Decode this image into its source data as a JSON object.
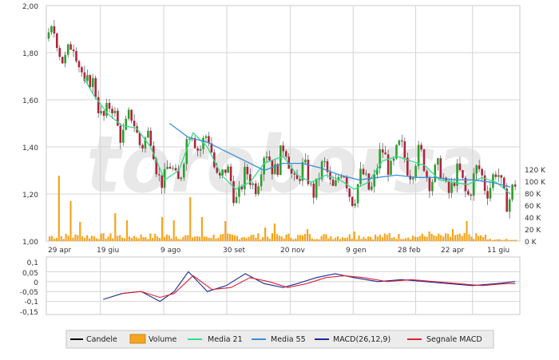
{
  "watermark": "toroborsa",
  "price_panel": {
    "y_ticks": [
      "2,00",
      "1,80",
      "1,60",
      "1,40",
      "1,20",
      "1,00"
    ],
    "volume_ticks": [
      "120 K",
      "100 K",
      "80 K",
      "60 K",
      "40 K",
      "20 K",
      "0 K"
    ],
    "x_ticks": [
      "29 apr",
      "19 giu",
      "9 ago",
      "30 set",
      "20 nov",
      "9 gen",
      "28 feb",
      "22 apr",
      "11 giu"
    ]
  },
  "macd_panel": {
    "y_ticks": [
      "0,1",
      "0,05",
      "0",
      "-0,05",
      "-0,1",
      "-0,15"
    ]
  },
  "legend": [
    {
      "label": "Candele",
      "color": "#000000",
      "kind": "line"
    },
    {
      "label": "Volume",
      "color": "#f5a51f",
      "kind": "box"
    },
    {
      "label": "Media 21",
      "color": "#33dd88",
      "kind": "line"
    },
    {
      "label": "Media 55",
      "color": "#3a8fd8",
      "kind": "line"
    },
    {
      "label": "MACD(26,12,9)",
      "color": "#1a2a99",
      "kind": "line"
    },
    {
      "label": "Segnale MACD",
      "color": "#dd2233",
      "kind": "line"
    }
  ],
  "colors": {
    "candle_up": "#2ca02c",
    "candle_down": "#b0243c",
    "volume": "#f5a51f",
    "media21": "#33dd88",
    "media55": "#3a8fd8",
    "macd": "#1a2a99",
    "signal": "#dd2233",
    "grid": "#d4d4d4"
  },
  "chart_data": [
    {
      "type": "candlestick",
      "series": [
        {
          "name": "Media 21",
          "x": [
            0.08,
            0.1,
            0.13,
            0.16,
            0.19,
            0.22,
            0.25,
            0.28,
            0.31,
            0.34,
            0.37,
            0.4,
            0.43,
            0.46,
            0.5,
            0.53,
            0.56,
            0.59,
            0.62,
            0.65,
            0.68,
            0.71,
            0.74,
            0.77,
            0.8,
            0.83,
            0.86,
            0.89,
            0.92,
            0.95,
            0.98
          ],
          "values": [
            1.69,
            1.62,
            1.54,
            1.49,
            1.48,
            1.4,
            1.26,
            1.3,
            1.46,
            1.4,
            1.28,
            1.22,
            1.25,
            1.33,
            1.36,
            1.28,
            1.25,
            1.28,
            1.26,
            1.22,
            1.25,
            1.34,
            1.36,
            1.34,
            1.32,
            1.26,
            1.25,
            1.24,
            1.27,
            1.25,
            1.2
          ]
        },
        {
          "name": "Media 55",
          "x": [
            0.26,
            0.3,
            0.34,
            0.38,
            0.42,
            0.46,
            0.5,
            0.54,
            0.58,
            0.62,
            0.66,
            0.7,
            0.74,
            0.78,
            0.82,
            0.86,
            0.9,
            0.94,
            0.98
          ],
          "values": [
            1.5,
            1.44,
            1.42,
            1.38,
            1.34,
            1.3,
            1.33,
            1.33,
            1.31,
            1.28,
            1.26,
            1.27,
            1.28,
            1.27,
            1.27,
            1.26,
            1.26,
            1.25,
            1.23
          ]
        },
        {
          "name": "MACD(26,12,9)",
          "x": [
            0.12,
            0.16,
            0.2,
            0.24,
            0.27,
            0.3,
            0.34,
            0.38,
            0.42,
            0.46,
            0.5,
            0.53,
            0.57,
            0.61,
            0.65,
            0.7,
            0.75,
            0.8,
            0.85,
            0.9,
            0.95,
            0.99
          ],
          "values": [
            -0.09,
            -0.06,
            -0.05,
            -0.1,
            -0.05,
            0.05,
            -0.05,
            -0.02,
            0.04,
            -0.01,
            -0.03,
            -0.01,
            0.02,
            0.04,
            0.02,
            0.0,
            0.01,
            0.0,
            -0.01,
            -0.02,
            -0.01,
            0.0
          ]
        },
        {
          "name": "Segnale MACD",
          "x": [
            0.16,
            0.2,
            0.24,
            0.27,
            0.31,
            0.35,
            0.39,
            0.43,
            0.47,
            0.51,
            0.55,
            0.59,
            0.63,
            0.67,
            0.72,
            0.77,
            0.82,
            0.87,
            0.92,
            0.97,
            0.99
          ],
          "values": [
            -0.06,
            -0.05,
            -0.08,
            -0.06,
            0.03,
            -0.04,
            -0.03,
            0.02,
            0.0,
            -0.03,
            -0.01,
            0.02,
            0.03,
            0.02,
            0.0,
            0.01,
            0.0,
            -0.01,
            -0.02,
            -0.01,
            -0.01
          ]
        }
      ]
    }
  ]
}
